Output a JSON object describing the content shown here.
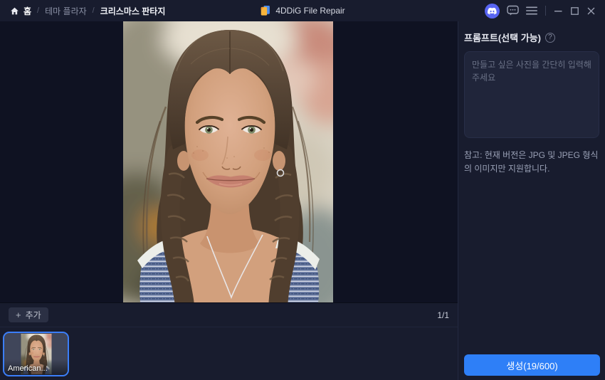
{
  "topbar": {
    "breadcrumb": {
      "home": "홈",
      "separator": "/",
      "theme_plaza": "테마 플라자",
      "current": "크리스마스 판타지"
    },
    "app_title": "4DDiG File Repair"
  },
  "workspace": {
    "add_button": {
      "plus": "+",
      "label": "추가"
    },
    "page_indicator": "1/1",
    "thumbnail_caption": "American..."
  },
  "prompt_panel": {
    "title": "프롬프트(선택 가능)",
    "help": "?",
    "placeholder": "만들고 싶은 사진을 간단히 입력해 주세요",
    "note": "참고: 현재 버전은 JPG 및 JPEG 형식의 이미지만 지원합니다.",
    "generate": "생성(19/600)"
  },
  "colors": {
    "accent": "#2e7ff7",
    "discord": "#5865F2",
    "thumbnail_border": "#3b7ef8",
    "topbar_bg": "#181c2e",
    "canvas_bg": "#0f1222"
  }
}
